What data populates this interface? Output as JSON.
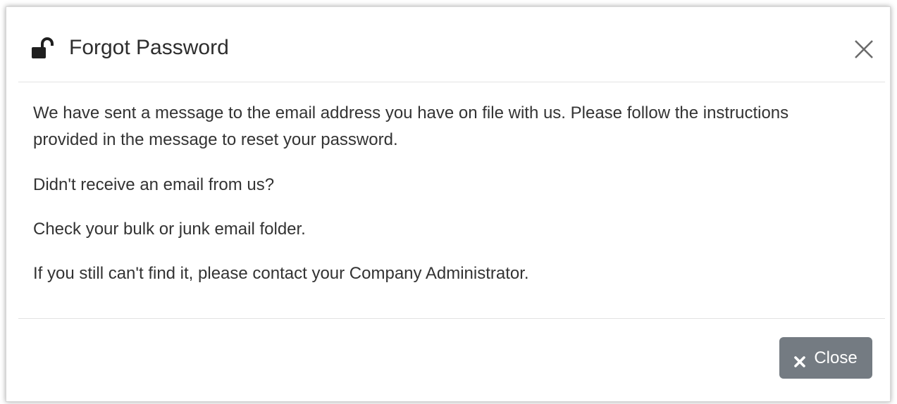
{
  "dialog": {
    "title": "Forgot Password",
    "title_icon": "unlock-icon",
    "dismiss_icon": "close-icon"
  },
  "body": {
    "paragraph_1_line_1": "We have sent a message to the email address you have on file with us. Please follow the instructions",
    "paragraph_1_line_2": "provided in the message to reset your password.",
    "paragraph_2": "Didn't receive an email from us?",
    "paragraph_3": "Check your bulk or junk email folder.",
    "paragraph_4": "If you still can't find it, please contact your Company Administrator."
  },
  "footer": {
    "close_label": "Close",
    "close_icon": "times-icon"
  },
  "colors": {
    "button_bg": "#747b82",
    "text": "#333333",
    "title": "#2d2d2d",
    "divider": "#e3e3e3"
  }
}
